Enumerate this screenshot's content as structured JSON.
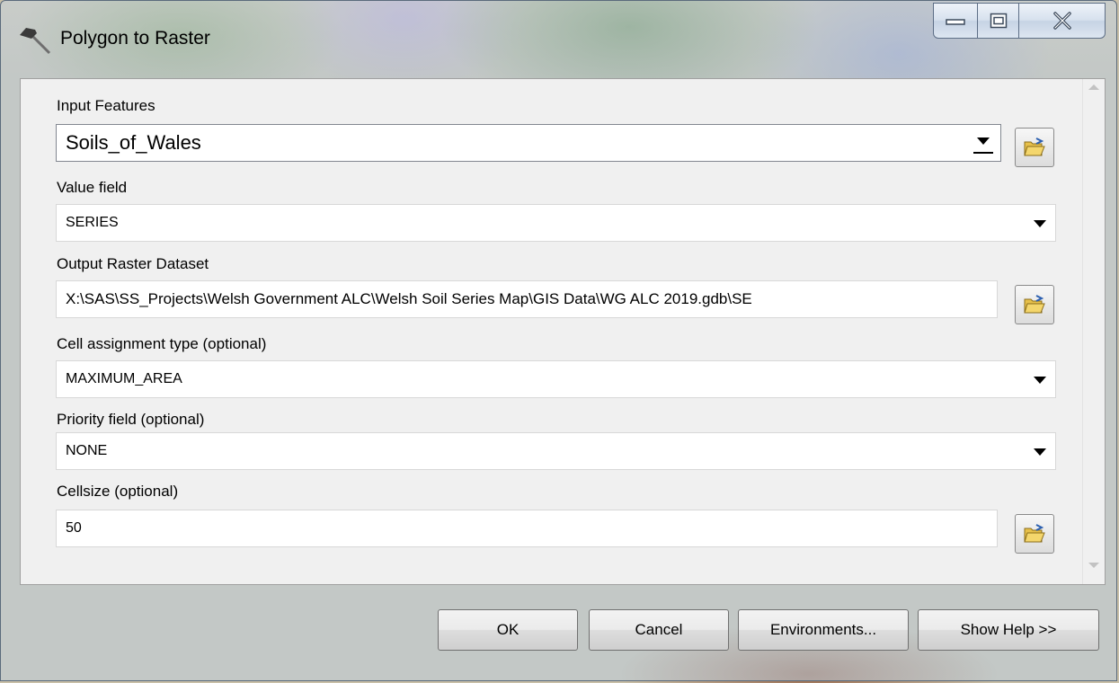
{
  "window": {
    "title": "Polygon to Raster"
  },
  "form": {
    "input_features": {
      "label": "Input Features",
      "value": "Soils_of_Wales"
    },
    "value_field": {
      "label": "Value field",
      "value": "SERIES"
    },
    "output_raster": {
      "label": "Output Raster Dataset",
      "value": "X:\\SAS\\SS_Projects\\Welsh Government ALC\\Welsh Soil Series Map\\GIS Data\\WG ALC 2019.gdb\\SE"
    },
    "cell_assignment": {
      "label": "Cell assignment type (optional)",
      "value": "MAXIMUM_AREA"
    },
    "priority_field": {
      "label": "Priority field (optional)",
      "value": "NONE"
    },
    "cellsize": {
      "label": "Cellsize (optional)",
      "value": "50"
    }
  },
  "buttons": {
    "ok": "OK",
    "cancel": "Cancel",
    "environments": "Environments...",
    "show_help": "Show Help >>"
  },
  "icons": {
    "title": "hammer-icon",
    "browse": "open-folder-icon"
  }
}
